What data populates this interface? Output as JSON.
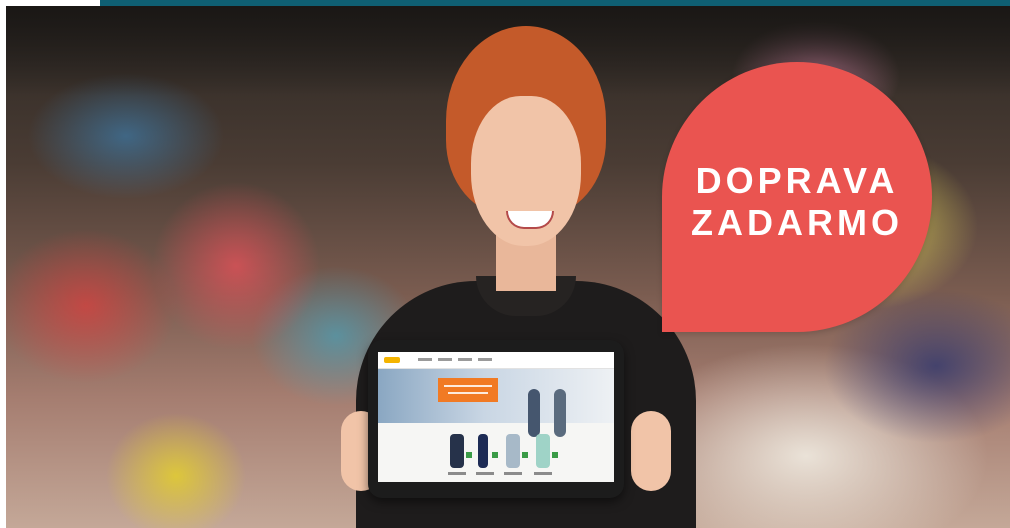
{
  "promo_badge": {
    "line1": "DOPRAVA",
    "line2": "ZADARMO",
    "color": "#ea5450"
  },
  "colors": {
    "top_bar": "#0f5f73"
  }
}
